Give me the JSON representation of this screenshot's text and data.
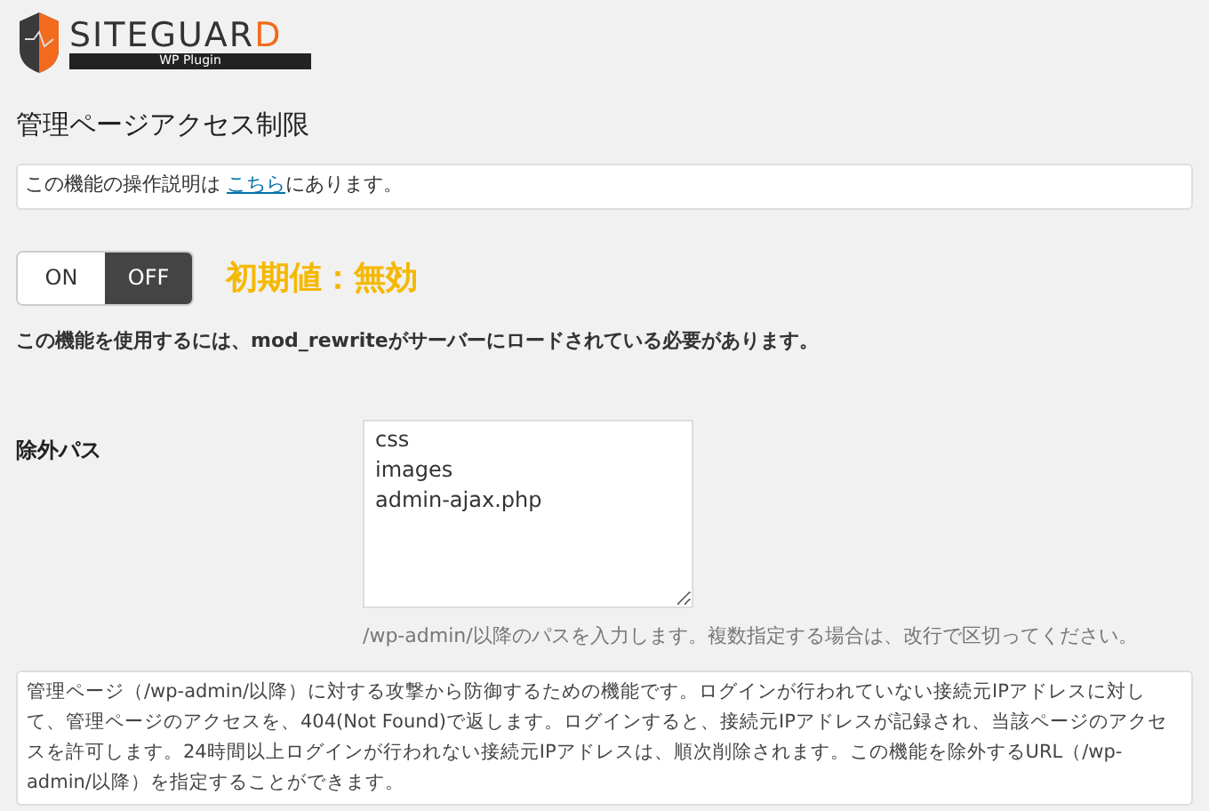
{
  "logo": {
    "name": "SITEGUARD",
    "tagline": "WP Plugin"
  },
  "title": "管理ページアクセス制限",
  "notice": {
    "before": "この機能の操作説明は ",
    "link": "こちら",
    "after": "にあります。"
  },
  "toggle": [
    {
      "label": "ON",
      "selected": false
    },
    {
      "label": "OFF",
      "selected": true
    }
  ],
  "default_note": "初期値：無効",
  "requirement": "この機能を使用するには、mod_rewriteがサーバーにロードされている必要があります。",
  "exclude": {
    "label": "除外パス",
    "value": "css\nimages\nadmin-ajax.php",
    "hint": "/wp-admin/以降のパスを入力します。複数指定する場合は、改行で区切ってください。"
  },
  "description": "管理ページ（/wp-admin/以降）に対する攻撃から防御するための機能です。ログインが行われていない接続元IPアドレスに対して、管理ページのアクセスを、404(Not Found)で返します。ログインすると、接続元IPアドレスが記録され、当該ページのアクセスを許可します。24時間以上ログインが行われない接続元IPアドレスは、順次削除されます。この機能を除外するURL（/wp-admin/以降）を指定することができます。"
}
